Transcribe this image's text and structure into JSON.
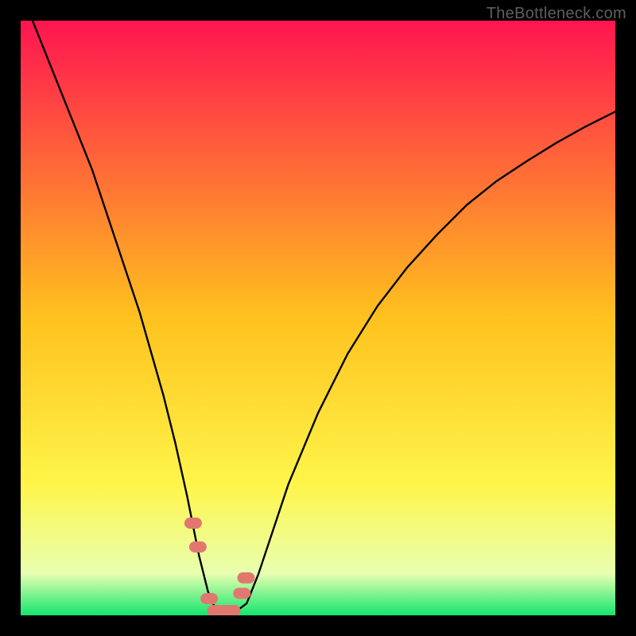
{
  "attribution": "TheBottleneck.com",
  "colors": {
    "page_bg": "#000000",
    "attribution_text": "#5f5f5f",
    "curve_stroke": "#000000",
    "mark_stroke": "#e07870",
    "gradient_stops": [
      {
        "offset": 0.0,
        "color": "#ff1450"
      },
      {
        "offset": 0.5,
        "color": "#ffc21e"
      },
      {
        "offset": 0.78,
        "color": "#fff54a"
      },
      {
        "offset": 0.93,
        "color": "#e8ffb0"
      },
      {
        "offset": 1.0,
        "color": "#14e66e"
      }
    ]
  },
  "chart_data": {
    "type": "line",
    "title": "",
    "xlabel": "",
    "ylabel": "",
    "xlim": [
      0,
      100
    ],
    "ylim": [
      0,
      100
    ],
    "x": [
      2,
      4,
      6,
      8,
      10,
      12,
      14,
      16,
      18,
      20,
      22,
      24,
      26,
      28,
      30,
      31.5,
      33,
      34.5,
      36,
      38,
      40,
      42,
      45,
      50,
      55,
      60,
      65,
      70,
      75,
      80,
      85,
      90,
      95,
      100
    ],
    "values": [
      100,
      95,
      90,
      85,
      80,
      75,
      69,
      63,
      57,
      51,
      44,
      37,
      29,
      20,
      10,
      4,
      0.5,
      0.5,
      0.5,
      2,
      7,
      13,
      22,
      34,
      44,
      52,
      58.5,
      64,
      69,
      73,
      76.3,
      79.4,
      82.2,
      84.7
    ],
    "optimal_marks_x": [
      29.0,
      29.8,
      31.7,
      33.0,
      34.5,
      35.5,
      37.2,
      37.9
    ],
    "optimal_marks_y": [
      15.5,
      11.5,
      2.8,
      0.8,
      0.8,
      0.8,
      3.7,
      6.3
    ]
  }
}
